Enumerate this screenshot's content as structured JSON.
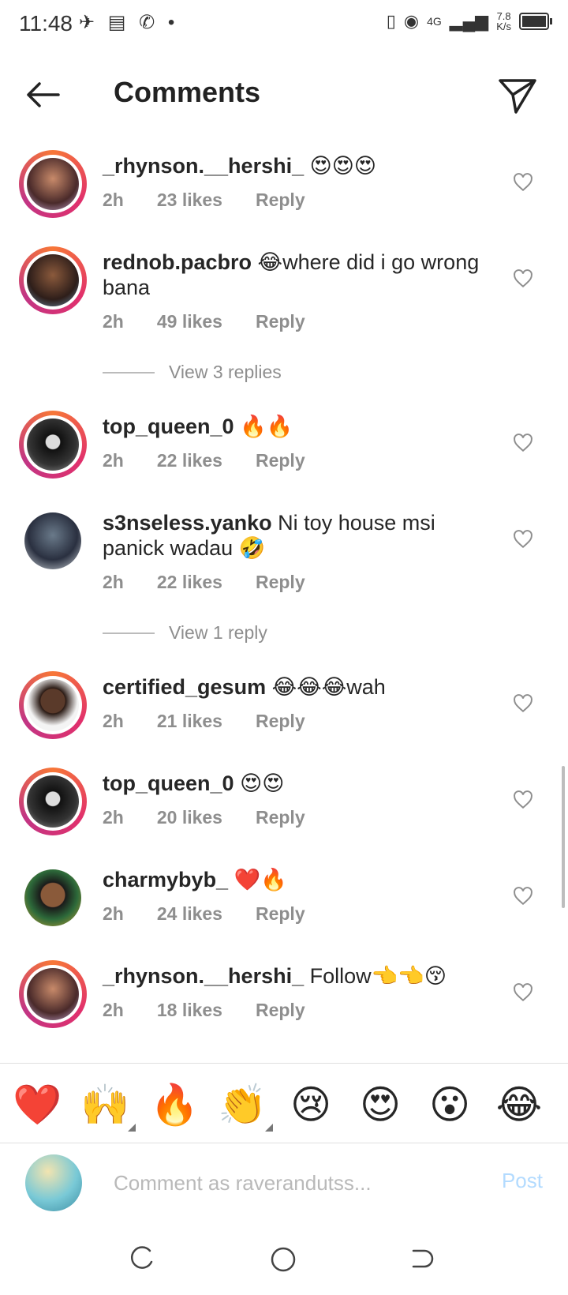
{
  "status_bar": {
    "time": "11:48",
    "net_speed_value": "7.8",
    "net_speed_unit": "K/s",
    "network_type": "4G"
  },
  "header": {
    "title": "Comments"
  },
  "comments": [
    {
      "username": "_rhynson.__hershi_",
      "text": "😍😍😍",
      "time": "2h",
      "likes": "23 likes",
      "reply": "Reply"
    },
    {
      "username": "rednob.pacbro",
      "text": "😂where did i go wrong bana",
      "time": "2h",
      "likes": "49 likes",
      "reply": "Reply",
      "replies": "View 3 replies"
    },
    {
      "username": "top_queen_0",
      "text": "🔥🔥",
      "time": "2h",
      "likes": "22 likes",
      "reply": "Reply"
    },
    {
      "username": "s3nseless.yanko",
      "text": "Ni toy house msi panick  wadau 🤣",
      "time": "2h",
      "likes": "22 likes",
      "reply": "Reply",
      "replies": "View 1 reply"
    },
    {
      "username": "certified_gesum",
      "text": "😂😂😂wah",
      "time": "2h",
      "likes": "21 likes",
      "reply": "Reply"
    },
    {
      "username": "top_queen_0",
      "text": "😍😍",
      "time": "2h",
      "likes": "20 likes",
      "reply": "Reply"
    },
    {
      "username": "charmybyb_",
      "text": "❤️🔥",
      "time": "2h",
      "likes": "24 likes",
      "reply": "Reply"
    },
    {
      "username": "_rhynson.__hershi_",
      "text": "Follow👈👈😚",
      "time": "2h",
      "likes": "18 likes",
      "reply": "Reply"
    }
  ],
  "reactions": [
    "❤️",
    "🙌",
    "🔥",
    "👏",
    "😢",
    "😍",
    "😮",
    "😂"
  ],
  "composer": {
    "placeholder": "Comment as raverandutss...",
    "post_label": "Post"
  },
  "colors": {
    "text": "#262626",
    "meta": "#8e8e8e",
    "post_disabled": "#b3dbff"
  }
}
